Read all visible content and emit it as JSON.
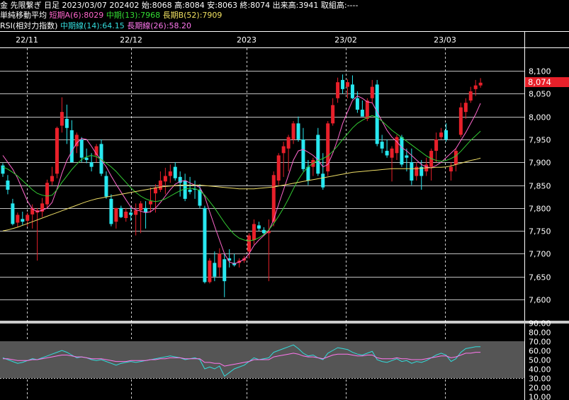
{
  "header": {
    "line1": "金 先限繋ぎ 日足 2023/03/07 202402 始:8068 高:8084 安:8063 終:8074 出来高:3941 取組高:----",
    "ma_label": "単純移動平均",
    "ma_short": "短期A(6):8029",
    "ma_mid": "中期(13):7968",
    "ma_long": "長期B(52):7909",
    "rsi_label": "RSI(相対力指数)",
    "rsi_mid": "中期線(14):64.15",
    "rsi_long": "長期線(26):58.20"
  },
  "last_price_label": "8,074",
  "colors": {
    "up": "#e8202a",
    "down": "#28e8f0",
    "ma_short": "#ff66cc",
    "ma_mid": "#33cc33",
    "ma_long": "#eedd66",
    "rsi_mid": "#33dddd",
    "rsi_long": "#ff77ee",
    "grid": "#ffffff",
    "background": "#000000"
  },
  "chart_data": [
    {
      "type": "candlestick",
      "x_labels": [
        "22/11",
        "22/12",
        "2023",
        "23/02",
        "23/03"
      ],
      "y_ticks": [
        "8,100",
        "8,050",
        "8,000",
        "7,950",
        "7,900",
        "7,850",
        "7,800",
        "7,750",
        "7,700",
        "7,650",
        "7,600"
      ],
      "ylim": [
        7580,
        8140
      ],
      "candles": [
        [
          7893,
          7898,
          7868,
          7875
        ],
        [
          7860,
          7872,
          7830,
          7840
        ],
        [
          7810,
          7820,
          7762,
          7765
        ],
        [
          7768,
          7790,
          7758,
          7785
        ],
        [
          7776,
          7792,
          7763,
          7770
        ],
        [
          7772,
          7790,
          7760,
          7785
        ],
        [
          7786,
          7808,
          7755,
          7800
        ],
        [
          7790,
          7800,
          7685,
          7795
        ],
        [
          7792,
          7822,
          7780,
          7810
        ],
        [
          7808,
          7862,
          7800,
          7855
        ],
        [
          7858,
          7890,
          7850,
          7870
        ],
        [
          7875,
          7978,
          7865,
          7975
        ],
        [
          7980,
          8042,
          7965,
          8010
        ],
        [
          7995,
          8026,
          7940,
          7975
        ],
        [
          7970,
          7992,
          7900,
          7900
        ],
        [
          7935,
          7965,
          7920,
          7960
        ],
        [
          7950,
          7955,
          7900,
          7910
        ],
        [
          7910,
          7930,
          7898,
          7905
        ],
        [
          7900,
          7920,
          7880,
          7890
        ],
        [
          7915,
          7940,
          7900,
          7935
        ],
        [
          7940,
          7950,
          7870,
          7875
        ],
        [
          7870,
          7880,
          7820,
          7825
        ],
        [
          7820,
          7830,
          7760,
          7765
        ],
        [
          7770,
          7800,
          7755,
          7800
        ],
        [
          7800,
          7805,
          7778,
          7780
        ],
        [
          7778,
          7800,
          7770,
          7792
        ],
        [
          7790,
          7802,
          7772,
          7785
        ],
        [
          7785,
          7810,
          7740,
          7795
        ],
        [
          7795,
          7815,
          7745,
          7810
        ],
        [
          7800,
          7815,
          7755,
          7790
        ],
        [
          7808,
          7845,
          7790,
          7815
        ],
        [
          7832,
          7852,
          7790,
          7845
        ],
        [
          7840,
          7880,
          7835,
          7860
        ],
        [
          7858,
          7888,
          7830,
          7870
        ],
        [
          7870,
          7895,
          7855,
          7880
        ],
        [
          7890,
          7900,
          7860,
          7865
        ],
        [
          7868,
          7880,
          7825,
          7855
        ],
        [
          7860,
          7875,
          7815,
          7820
        ],
        [
          7840,
          7868,
          7830,
          7835
        ],
        [
          7842,
          7860,
          7820,
          7840
        ],
        [
          7840,
          7852,
          7800,
          7805
        ],
        [
          7800,
          7805,
          7635,
          7638
        ],
        [
          7638,
          7690,
          7635,
          7685
        ],
        [
          7680,
          7705,
          7640,
          7650
        ],
        [
          7670,
          7712,
          7650,
          7700
        ],
        [
          7688,
          7700,
          7605,
          7640
        ],
        [
          7690,
          7710,
          7670,
          7685
        ],
        [
          7680,
          7700,
          7672,
          7675
        ],
        [
          7680,
          7690,
          7670,
          7685
        ],
        [
          7685,
          7695,
          7680,
          7690
        ],
        [
          7705,
          7745,
          7690,
          7740
        ],
        [
          7730,
          7775,
          7720,
          7765
        ],
        [
          7762,
          7770,
          7750,
          7755
        ],
        [
          7752,
          7758,
          7740,
          7745
        ],
        [
          7745,
          7775,
          7640,
          7750
        ],
        [
          7770,
          7880,
          7760,
          7872
        ],
        [
          7860,
          7920,
          7850,
          7915
        ],
        [
          7920,
          7945,
          7868,
          7935
        ],
        [
          7930,
          7960,
          7880,
          7955
        ],
        [
          7950,
          7990,
          7940,
          7985
        ],
        [
          7985,
          8000,
          7945,
          7950
        ],
        [
          7950,
          7975,
          7880,
          7885
        ],
        [
          7890,
          7905,
          7850,
          7860
        ],
        [
          7890,
          7910,
          7870,
          7905
        ],
        [
          7960,
          7975,
          7870,
          7875
        ],
        [
          7875,
          7920,
          7840,
          7845
        ],
        [
          7880,
          7990,
          7870,
          7985
        ],
        [
          7985,
          8040,
          7980,
          8025
        ],
        [
          8040,
          8085,
          8030,
          8075
        ],
        [
          8080,
          8092,
          8050,
          8060
        ],
        [
          8065,
          8082,
          8040,
          8075
        ],
        [
          8070,
          8090,
          8038,
          8040
        ],
        [
          8040,
          8055,
          8008,
          8015
        ],
        [
          8015,
          8035,
          8000,
          8000
        ],
        [
          7995,
          8040,
          7990,
          8035
        ],
        [
          8040,
          8080,
          8030,
          8065
        ],
        [
          8070,
          8080,
          7935,
          7940
        ],
        [
          7945,
          7960,
          7920,
          7930
        ],
        [
          7925,
          7950,
          7910,
          7915
        ],
        [
          7910,
          7935,
          7858,
          7930
        ],
        [
          7920,
          7960,
          7905,
          7955
        ],
        [
          7955,
          7960,
          7890,
          7895
        ],
        [
          7915,
          7930,
          7880,
          7910
        ],
        [
          7900,
          7930,
          7850,
          7860
        ],
        [
          7870,
          7900,
          7860,
          7890
        ],
        [
          7890,
          7905,
          7840,
          7870
        ],
        [
          7880,
          7910,
          7870,
          7895
        ],
        [
          7890,
          7930,
          7860,
          7925
        ],
        [
          7925,
          7965,
          7900,
          7950
        ],
        [
          7955,
          7975,
          7950,
          7965
        ],
        [
          7970,
          7985,
          7945,
          7950
        ],
        [
          7880,
          7900,
          7860,
          7890
        ],
        [
          7895,
          7930,
          7880,
          7925
        ],
        [
          7960,
          8030,
          7955,
          8020
        ],
        [
          8010,
          8040,
          7995,
          8030
        ],
        [
          8035,
          8065,
          8030,
          8055
        ],
        [
          8060,
          8080,
          8045,
          8068
        ],
        [
          8068,
          8084,
          8063,
          8074
        ]
      ],
      "series": [
        {
          "name": "短期A(6)",
          "values": [
            7915,
            7900,
            7885,
            7865,
            7840,
            7815,
            7798,
            7792,
            7795,
            7800,
            7812,
            7842,
            7876,
            7904,
            7924,
            7942,
            7952,
            7950,
            7935,
            7918,
            7905,
            7890,
            7870,
            7852,
            7835,
            7818,
            7802,
            7796,
            7793,
            7790,
            7792,
            7800,
            7812,
            7826,
            7840,
            7852,
            7858,
            7860,
            7855,
            7850,
            7845,
            7825,
            7792,
            7760,
            7730,
            7700,
            7682,
            7678,
            7682,
            7688,
            7700,
            7718,
            7730,
            7740,
            7750,
            7775,
            7808,
            7840,
            7872,
            7905,
            7925,
            7928,
            7922,
            7915,
            7905,
            7890,
            7895,
            7920,
            7950,
            7985,
            8010,
            8035,
            8045,
            8040,
            8032,
            8030,
            8010,
            7990,
            7970,
            7955,
            7945,
            7932,
            7925,
            7915,
            7905,
            7895,
            7890,
            7888,
            7893,
            7900,
            7910,
            7920,
            7930,
            7948,
            7965,
            7985,
            8005,
            8029
          ]
        },
        {
          "name": "中期(13)",
          "values": [
            7890,
            7885,
            7878,
            7870,
            7860,
            7850,
            7840,
            7832,
            7828,
            7826,
            7828,
            7840,
            7856,
            7870,
            7884,
            7896,
            7906,
            7912,
            7915,
            7912,
            7906,
            7898,
            7890,
            7880,
            7868,
            7856,
            7844,
            7834,
            7826,
            7820,
            7816,
            7814,
            7816,
            7820,
            7826,
            7832,
            7838,
            7842,
            7843,
            7842,
            7838,
            7828,
            7814,
            7800,
            7784,
            7768,
            7754,
            7742,
            7734,
            7730,
            7728,
            7730,
            7735,
            7742,
            7752,
            7766,
            7782,
            7800,
            7820,
            7842,
            7862,
            7878,
            7890,
            7898,
            7904,
            7908,
            7914,
            7924,
            7936,
            7950,
            7962,
            7975,
            7985,
            7992,
            7998,
            8002,
            7998,
            7990,
            7980,
            7970,
            7962,
            7954,
            7946,
            7938,
            7930,
            7922,
            7914,
            7908,
            7904,
            7902,
            7904,
            7908,
            7914,
            7924,
            7936,
            7948,
            7958,
            7968
          ]
        },
        {
          "name": "長期B(52)",
          "values": [
            7750,
            7752,
            7755,
            7758,
            7762,
            7766,
            7770,
            7774,
            7778,
            7782,
            7786,
            7790,
            7794,
            7798,
            7802,
            7806,
            7810,
            7814,
            7817,
            7820,
            7822,
            7824,
            7826,
            7828,
            7830,
            7832,
            7834,
            7836,
            7838,
            7840,
            7842,
            7844,
            7846,
            7847,
            7848,
            7849,
            7850,
            7850,
            7850,
            7850,
            7850,
            7849,
            7848,
            7847,
            7846,
            7845,
            7844,
            7843,
            7842,
            7842,
            7842,
            7842,
            7843,
            7844,
            7845,
            7846,
            7848,
            7850,
            7852,
            7854,
            7856,
            7858,
            7860,
            7862,
            7864,
            7866,
            7868,
            7870,
            7872,
            7874,
            7876,
            7878,
            7879,
            7880,
            7881,
            7882,
            7883,
            7884,
            7885,
            7886,
            7886,
            7886,
            7886,
            7886,
            7886,
            7887,
            7888,
            7888,
            7889,
            7889,
            7890,
            7892,
            7895,
            7898,
            7901,
            7904,
            7906,
            7909
          ]
        }
      ]
    },
    {
      "type": "line",
      "title": "RSI",
      "y_ticks": [
        "90.00",
        "80.00",
        "70.00",
        "60.00",
        "50.00",
        "40.00",
        "30.00",
        "20.00",
        "10.00"
      ],
      "ylim": [
        5,
        92
      ],
      "series": [
        {
          "name": "中期線(14)",
          "values": [
            52,
            50,
            48,
            46,
            47,
            49,
            51,
            50,
            52,
            54,
            56,
            58,
            60,
            58,
            55,
            52,
            53,
            52,
            50,
            49,
            50,
            48,
            46,
            44,
            46,
            47,
            48,
            47,
            48,
            49,
            50,
            51,
            52,
            53,
            54,
            53,
            52,
            50,
            51,
            52,
            50,
            40,
            42,
            40,
            43,
            32,
            36,
            40,
            42,
            44,
            48,
            52,
            50,
            51,
            52,
            58,
            60,
            62,
            64,
            66,
            62,
            57,
            54,
            55,
            52,
            50,
            57,
            60,
            63,
            62,
            61,
            58,
            56,
            55,
            57,
            59,
            50,
            48,
            47,
            49,
            51,
            48,
            49,
            46,
            48,
            47,
            49,
            52,
            55,
            57,
            55,
            48,
            51,
            58,
            62,
            63,
            64,
            64
          ]
        },
        {
          "name": "長期線(26)",
          "values": [
            51,
            51,
            50,
            49,
            49,
            49,
            50,
            50,
            51,
            52,
            53,
            54,
            55,
            55,
            54,
            53,
            53,
            52,
            51,
            51,
            51,
            50,
            49,
            48,
            48,
            48,
            49,
            49,
            49,
            49,
            50,
            50,
            51,
            51,
            52,
            52,
            52,
            51,
            51,
            51,
            51,
            47,
            47,
            46,
            46,
            43,
            44,
            45,
            46,
            47,
            48,
            50,
            50,
            50,
            50,
            53,
            54,
            55,
            56,
            57,
            56,
            54,
            53,
            53,
            52,
            51,
            53,
            55,
            56,
            56,
            56,
            55,
            54,
            54,
            55,
            55,
            52,
            51,
            51,
            51,
            52,
            51,
            51,
            50,
            50,
            50,
            51,
            52,
            53,
            54,
            54,
            52,
            53,
            55,
            57,
            57,
            58,
            58
          ]
        }
      ]
    }
  ]
}
